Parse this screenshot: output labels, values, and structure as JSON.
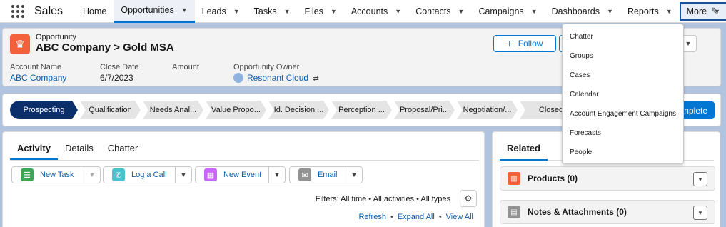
{
  "nav": {
    "app_name": "Sales",
    "items": [
      {
        "label": "Home",
        "has_menu": false
      },
      {
        "label": "Opportunities",
        "has_menu": true,
        "active": true
      },
      {
        "label": "Leads",
        "has_menu": true
      },
      {
        "label": "Tasks",
        "has_menu": true
      },
      {
        "label": "Files",
        "has_menu": true
      },
      {
        "label": "Accounts",
        "has_menu": true
      },
      {
        "label": "Contacts",
        "has_menu": true
      },
      {
        "label": "Campaigns",
        "has_menu": true
      },
      {
        "label": "Dashboards",
        "has_menu": true
      },
      {
        "label": "Reports",
        "has_menu": true
      },
      {
        "label": "More",
        "has_menu": true,
        "open": true
      }
    ]
  },
  "record": {
    "object_type": "Opportunity",
    "name": "ABC Company > Gold MSA",
    "follow_label": "Follow",
    "fields": {
      "account_name_label": "Account Name",
      "account_name_value": "ABC Company",
      "close_date_label": "Close Date",
      "close_date_value": "6/7/2023",
      "amount_label": "Amount",
      "owner_label": "Opportunity Owner",
      "owner_value": "Resonant Cloud"
    }
  },
  "path": {
    "stages": [
      {
        "label": "Prospecting",
        "current": true
      },
      {
        "label": "Qualification"
      },
      {
        "label": "Needs Anal..."
      },
      {
        "label": "Value Propo..."
      },
      {
        "label": "Id. Decision ..."
      },
      {
        "label": "Perception ..."
      },
      {
        "label": "Proposal/Pri..."
      },
      {
        "label": "Negotiation/..."
      },
      {
        "label": "Closed"
      }
    ],
    "mark_complete_label": "nplete"
  },
  "activity": {
    "tabs": [
      "Activity",
      "Details",
      "Chatter"
    ],
    "buttons": {
      "new_task": "New Task",
      "log_call": "Log a Call",
      "new_event": "New Event",
      "email": "Email"
    },
    "filters_text": "Filters: All time • All activities • All types",
    "refresh": "Refresh",
    "expand_all": "Expand All",
    "view_all": "View All"
  },
  "related": {
    "tab": "Related",
    "items": [
      {
        "title": "Products (0)"
      },
      {
        "title": "Notes & Attachments (0)"
      }
    ]
  },
  "more_menu": {
    "items": [
      "Chatter",
      "Groups",
      "Cases",
      "Calendar",
      "Account Engagement Campaigns",
      "Forecasts",
      "People"
    ]
  },
  "colors": {
    "brand_blue": "#0176d3",
    "path_current": "#0b2f6b",
    "opportunity_icon": "#f2613c",
    "task_icon": "#3ba755",
    "call_icon": "#48c3cc",
    "event_icon": "#cb65ff",
    "email_icon": "#939393",
    "products_icon": "#f2613c",
    "notes_icon": "#939393"
  }
}
